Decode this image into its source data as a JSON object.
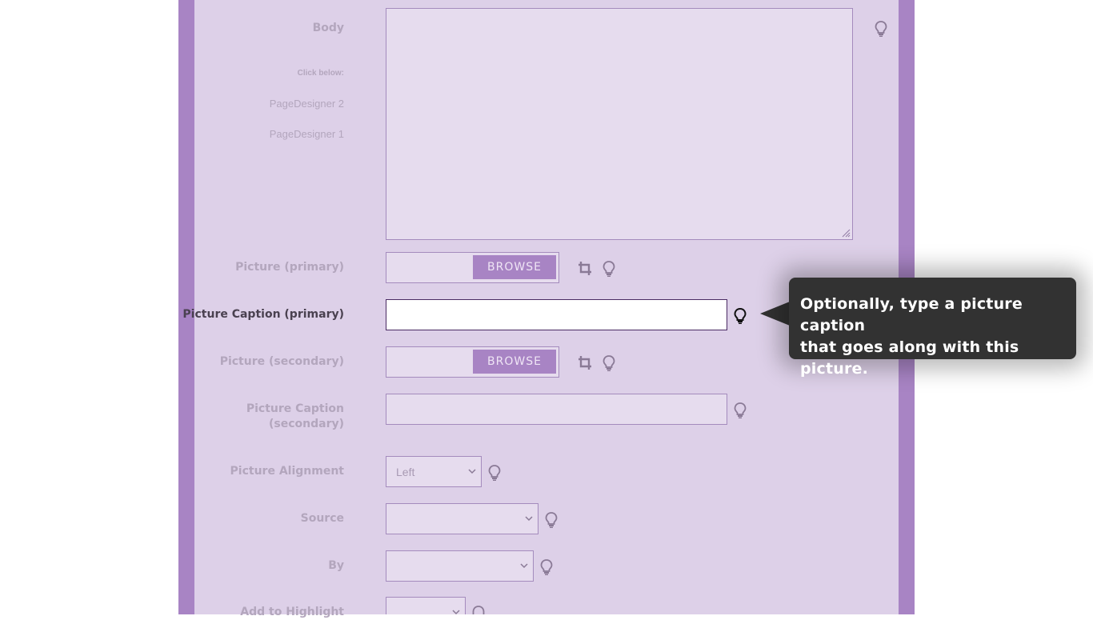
{
  "form": {
    "body": {
      "label": "Body"
    },
    "helpers": {
      "click_below": "Click below:",
      "page_designer_2": "PageDesigner 2",
      "page_designer_1": "PageDesigner 1"
    },
    "picture_primary": {
      "label": "Picture (primary)",
      "browse_label": "BROWSE"
    },
    "caption_primary": {
      "label": "Picture Caption (primary)",
      "value": ""
    },
    "picture_secondary": {
      "label": "Picture (secondary)",
      "browse_label": "BROWSE"
    },
    "caption_secondary": {
      "label_line1": "Picture Caption",
      "label_line2": "(secondary)",
      "value": ""
    },
    "alignment": {
      "label": "Picture Alignment",
      "selected": "Left"
    },
    "source": {
      "label": "Source",
      "selected": ""
    },
    "by": {
      "label": "By",
      "selected": ""
    },
    "highlight": {
      "label": "Add to Highlight",
      "selected": ""
    }
  },
  "tooltip": {
    "line1": "Optionally, type a picture caption",
    "line2": "that goes along with this picture."
  },
  "colors": {
    "frame": "#a884c4",
    "panel": "#ddd0e8",
    "field": "#e6dcee",
    "button": "#a884c4",
    "tooltip": "#323232"
  },
  "icons": [
    "lightbulb-icon",
    "crop-icon",
    "resize-handle-icon",
    "chevron-down-icon"
  ]
}
